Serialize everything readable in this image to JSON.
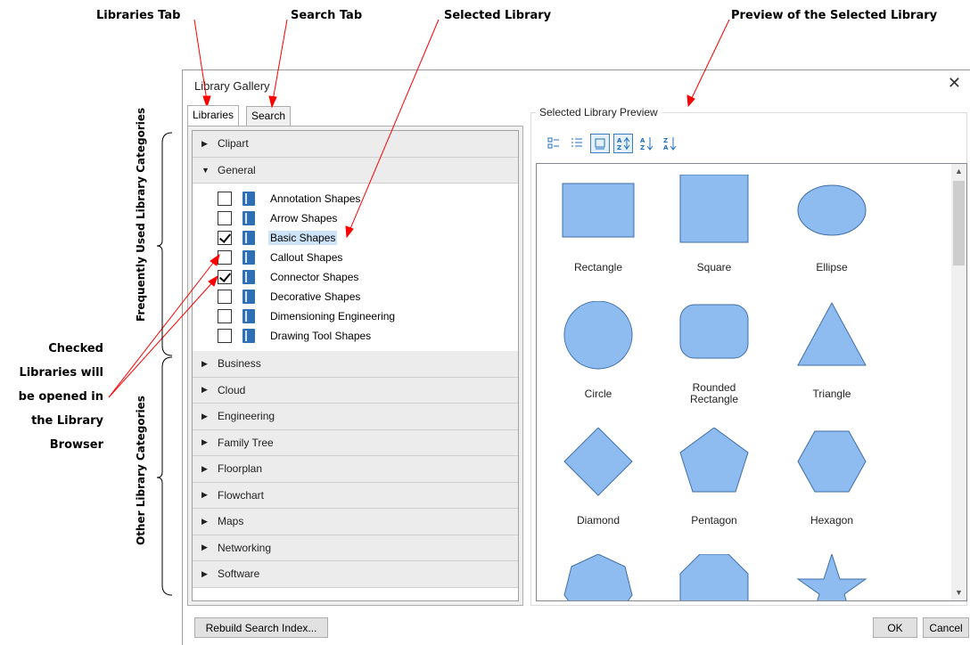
{
  "annotations": {
    "libraries_tab": "Libraries Tab",
    "search_tab": "Search Tab",
    "selected_library": "Selected Library",
    "preview": "Preview of the Selected Library",
    "frequently_used": "Frequently Used Library Categories",
    "other_categories": "Other Library Categories",
    "checked_line1": "Checked",
    "checked_line2": "Libraries will",
    "checked_line3": "be opened in",
    "checked_line4": "the Library",
    "checked_line5": "Browser"
  },
  "dialog": {
    "title": "Library Gallery",
    "close_glyph": "✕",
    "tabs": [
      {
        "label": "Libraries",
        "active": true
      },
      {
        "label": "Search",
        "active": false
      }
    ],
    "top_categories": [
      {
        "label": "Clipart",
        "expanded": false
      },
      {
        "label": "General",
        "expanded": true
      }
    ],
    "libraries": [
      {
        "label": "Annotation Shapes",
        "checked": false,
        "selected": false
      },
      {
        "label": "Arrow Shapes",
        "checked": false,
        "selected": false
      },
      {
        "label": "Basic Shapes",
        "checked": true,
        "selected": true
      },
      {
        "label": "Callout Shapes",
        "checked": false,
        "selected": false
      },
      {
        "label": "Connector Shapes",
        "checked": true,
        "selected": false
      },
      {
        "label": "Decorative Shapes",
        "checked": false,
        "selected": false
      },
      {
        "label": "Dimensioning Engineering",
        "checked": false,
        "selected": false
      },
      {
        "label": "Drawing Tool Shapes",
        "checked": false,
        "selected": false
      }
    ],
    "other_categories": [
      {
        "label": "Business"
      },
      {
        "label": "Cloud"
      },
      {
        "label": "Engineering"
      },
      {
        "label": "Family Tree"
      },
      {
        "label": "Floorplan"
      },
      {
        "label": "Flowchart"
      },
      {
        "label": "Maps"
      },
      {
        "label": "Networking"
      },
      {
        "label": "Software"
      }
    ],
    "preview": {
      "title": "Selected Library Preview",
      "toolbar": [
        {
          "icon": "large-icons-view-icon",
          "pressed": false
        },
        {
          "icon": "list-view-icon",
          "pressed": false
        },
        {
          "icon": "icons-only-view-icon",
          "pressed": true
        },
        {
          "icon": "no-sort-icon",
          "pressed": true
        },
        {
          "icon": "sort-ascending-icon",
          "pressed": false
        },
        {
          "icon": "sort-descending-icon",
          "pressed": false
        }
      ],
      "shapes": [
        {
          "label": "Rectangle",
          "kind": "rectangle"
        },
        {
          "label": "Square",
          "kind": "square"
        },
        {
          "label": "Ellipse",
          "kind": "ellipse"
        },
        {
          "label": "Circle",
          "kind": "circle"
        },
        {
          "label": "Rounded Rectangle",
          "kind": "rounded-rectangle"
        },
        {
          "label": "Triangle",
          "kind": "triangle"
        },
        {
          "label": "Diamond",
          "kind": "diamond"
        },
        {
          "label": "Pentagon",
          "kind": "pentagon"
        },
        {
          "label": "Hexagon",
          "kind": "hexagon"
        },
        {
          "label": "",
          "kind": "heptagon"
        },
        {
          "label": "",
          "kind": "octagon"
        },
        {
          "label": "",
          "kind": "star"
        }
      ],
      "shape_fill": "#8fbcf0",
      "shape_stroke": "#3f6fa8"
    },
    "buttons": {
      "rebuild": "Rebuild Search Index...",
      "ok": "OK",
      "cancel": "Cancel"
    }
  },
  "colors": {
    "selection": "#cde3f7",
    "annotation_line": "#ff0000",
    "icon_blue": "#2f6fb5"
  }
}
